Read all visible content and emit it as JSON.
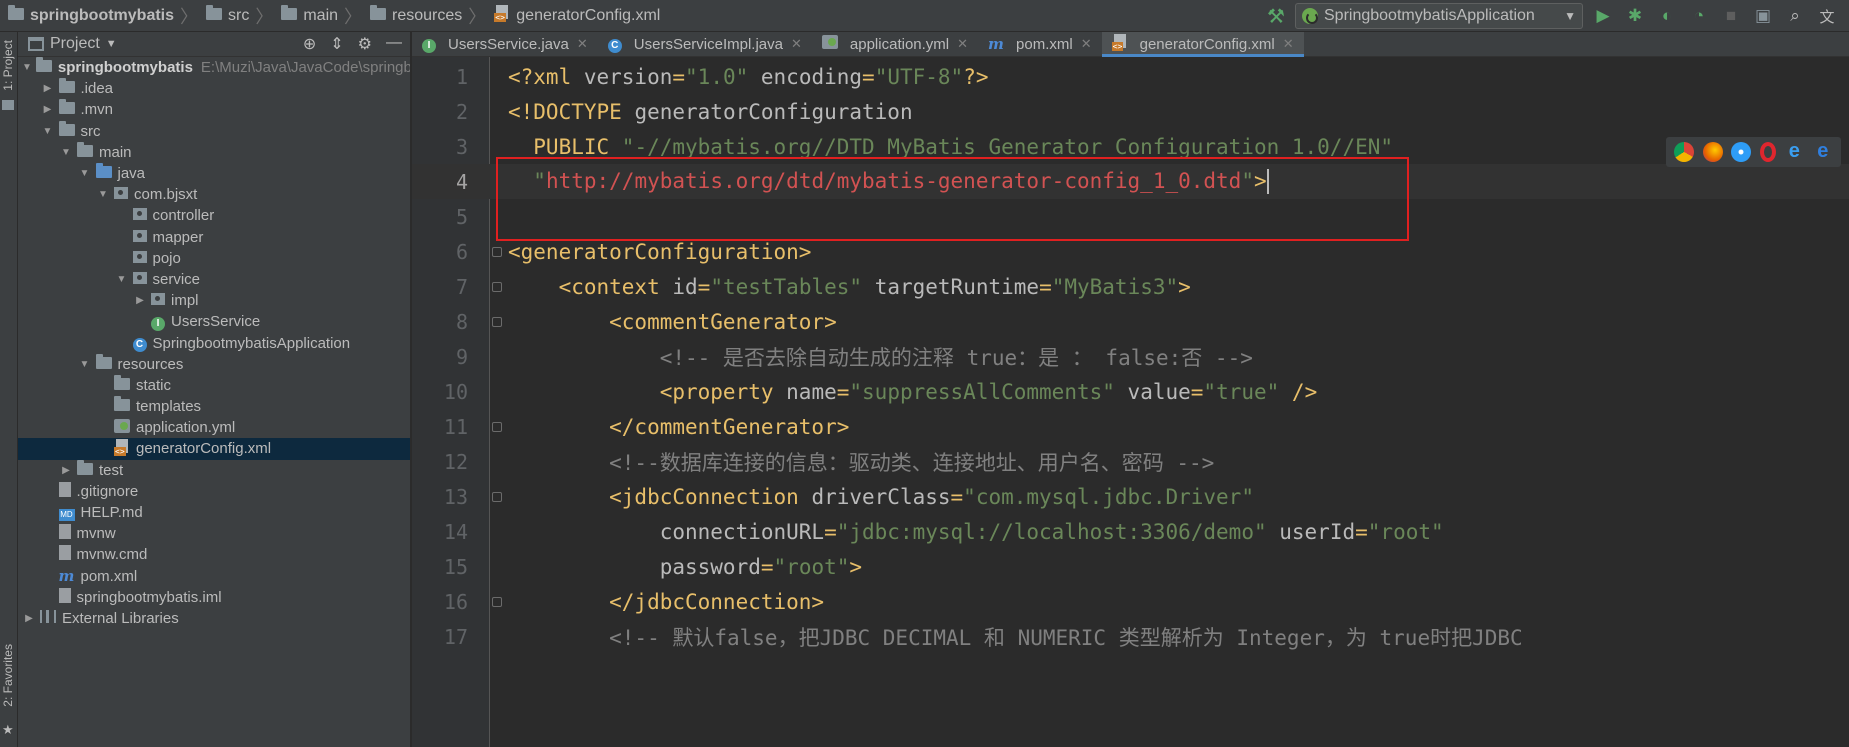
{
  "breadcrumb": [
    {
      "label": "springbootmybatis",
      "icon": "folder-icon"
    },
    {
      "label": "src",
      "icon": "folder-icon"
    },
    {
      "label": "main",
      "icon": "folder-icon"
    },
    {
      "label": "resources",
      "icon": "resources-folder-icon"
    },
    {
      "label": "generatorConfig.xml",
      "icon": "xml-file-icon"
    }
  ],
  "toolbar": {
    "run_config": "SpringbootmybatisApplication"
  },
  "left_strip": {
    "project_label": "1: Project",
    "favorites_label": "2: Favorites"
  },
  "project_panel": {
    "title": "Project",
    "tree": [
      {
        "depth": 0,
        "arrow": "down",
        "icon": "module-folder-icon",
        "label": "springbootmybatis",
        "bold": true,
        "path": "E:\\Muzi\\Java\\JavaCode\\springboot\\s"
      },
      {
        "depth": 1,
        "arrow": "right",
        "icon": "folder-icon",
        "label": ".idea"
      },
      {
        "depth": 1,
        "arrow": "right",
        "icon": "folder-icon",
        "label": ".mvn"
      },
      {
        "depth": 1,
        "arrow": "down",
        "icon": "folder-icon",
        "label": "src"
      },
      {
        "depth": 2,
        "arrow": "down",
        "icon": "folder-icon",
        "label": "main"
      },
      {
        "depth": 3,
        "arrow": "down",
        "icon": "source-folder-icon",
        "label": "java"
      },
      {
        "depth": 4,
        "arrow": "down",
        "icon": "package-icon",
        "label": "com.bjsxt"
      },
      {
        "depth": 5,
        "arrow": "none",
        "icon": "package-icon",
        "label": "controller"
      },
      {
        "depth": 5,
        "arrow": "none",
        "icon": "package-icon",
        "label": "mapper"
      },
      {
        "depth": 5,
        "arrow": "none",
        "icon": "package-icon",
        "label": "pojo"
      },
      {
        "depth": 5,
        "arrow": "down",
        "icon": "package-icon",
        "label": "service"
      },
      {
        "depth": 6,
        "arrow": "right",
        "icon": "package-icon",
        "label": "impl"
      },
      {
        "depth": 6,
        "arrow": "none",
        "icon": "interface-icon",
        "label": "UsersService"
      },
      {
        "depth": 5,
        "arrow": "none",
        "icon": "spring-boot-class-icon",
        "label": "SpringbootmybatisApplication"
      },
      {
        "depth": 3,
        "arrow": "down",
        "icon": "resources-folder-icon",
        "label": "resources"
      },
      {
        "depth": 4,
        "arrow": "none",
        "icon": "folder-icon",
        "label": "static"
      },
      {
        "depth": 4,
        "arrow": "none",
        "icon": "folder-icon",
        "label": "templates"
      },
      {
        "depth": 4,
        "arrow": "none",
        "icon": "yml-file-icon",
        "label": "application.yml"
      },
      {
        "depth": 4,
        "arrow": "none",
        "icon": "xml-file-icon",
        "label": "generatorConfig.xml",
        "selected": true
      },
      {
        "depth": 2,
        "arrow": "right",
        "icon": "folder-icon",
        "label": "test"
      },
      {
        "depth": 1,
        "arrow": "none",
        "icon": "gitignore-file-icon",
        "label": ".gitignore"
      },
      {
        "depth": 1,
        "arrow": "none",
        "icon": "markdown-file-icon",
        "label": "HELP.md"
      },
      {
        "depth": 1,
        "arrow": "none",
        "icon": "text-file-icon",
        "label": "mvnw"
      },
      {
        "depth": 1,
        "arrow": "none",
        "icon": "text-file-icon",
        "label": "mvnw.cmd"
      },
      {
        "depth": 1,
        "arrow": "none",
        "icon": "maven-icon",
        "label": "pom.xml"
      },
      {
        "depth": 1,
        "arrow": "none",
        "icon": "iml-file-icon",
        "label": "springbootmybatis.iml"
      },
      {
        "depth": 0,
        "arrow": "right",
        "icon": "libraries-icon",
        "label": "External Libraries"
      }
    ]
  },
  "tabs": [
    {
      "label": "UsersService.java",
      "icon": "interface-icon",
      "active": false
    },
    {
      "label": "UsersServiceImpl.java",
      "icon": "class-icon",
      "active": false
    },
    {
      "label": "application.yml",
      "icon": "yml-file-icon",
      "active": false
    },
    {
      "label": "pom.xml",
      "icon": "maven-icon",
      "active": false
    },
    {
      "label": "generatorConfig.xml",
      "icon": "xml-file-icon",
      "active": true
    }
  ],
  "editor": {
    "current_line": 4,
    "lines": [
      {
        "n": "1",
        "fold": false,
        "segments": [
          [
            "tag",
            "<?xml "
          ],
          [
            "attr",
            "version"
          ],
          [
            "tag",
            "="
          ],
          [
            "val",
            "\"1.0\""
          ],
          [
            "attr",
            " encoding"
          ],
          [
            "tag",
            "="
          ],
          [
            "val",
            "\"UTF-8\""
          ],
          [
            "tag",
            "?>"
          ]
        ]
      },
      {
        "n": "2",
        "fold": false,
        "segments": [
          [
            "tag",
            "<!DOCTYPE "
          ],
          [
            "attr",
            "generatorConfiguration"
          ]
        ]
      },
      {
        "n": "3",
        "fold": false,
        "segments": [
          [
            "tag",
            "  PUBLIC "
          ],
          [
            "val",
            "\"-//mybatis.org//DTD MyBatis Generator Configuration 1.0//EN\""
          ]
        ]
      },
      {
        "n": "4",
        "fold": false,
        "segments": [
          [
            "tag",
            "  "
          ],
          [
            "val",
            "\""
          ],
          [
            "red",
            "http://mybatis.org/dtd/mybatis-generator-config_1_0.dtd"
          ],
          [
            "val",
            "\""
          ],
          [
            "tag",
            ">"
          ]
        ],
        "cursor": true
      },
      {
        "n": "5",
        "fold": false,
        "segments": []
      },
      {
        "n": "6",
        "fold": true,
        "segments": [
          [
            "tag",
            "<generatorConfiguration>"
          ]
        ]
      },
      {
        "n": "7",
        "fold": true,
        "segments": [
          [
            "tag",
            "    <context "
          ],
          [
            "attr",
            "id"
          ],
          [
            "tag",
            "="
          ],
          [
            "val",
            "\"testTables\""
          ],
          [
            "attr",
            " targetRuntime"
          ],
          [
            "tag",
            "="
          ],
          [
            "val",
            "\"MyBatis3\""
          ],
          [
            "tag",
            ">"
          ]
        ]
      },
      {
        "n": "8",
        "fold": true,
        "segments": [
          [
            "tag",
            "        <commentGenerator>"
          ]
        ]
      },
      {
        "n": "9",
        "fold": false,
        "segments": [
          [
            "com",
            "            <!-- 是否去除自动生成的注释 true：是 ： false:否 -->"
          ]
        ]
      },
      {
        "n": "10",
        "fold": false,
        "segments": [
          [
            "tag",
            "            <property "
          ],
          [
            "attr",
            "name"
          ],
          [
            "tag",
            "="
          ],
          [
            "val",
            "\"suppressAllComments\""
          ],
          [
            "attr",
            " value"
          ],
          [
            "tag",
            "="
          ],
          [
            "val",
            "\"true\""
          ],
          [
            "tag",
            " />"
          ]
        ]
      },
      {
        "n": "11",
        "fold": true,
        "segments": [
          [
            "tag",
            "        </commentGenerator>"
          ]
        ]
      },
      {
        "n": "12",
        "fold": false,
        "segments": [
          [
            "com",
            "        <!--数据库连接的信息：驱动类、连接地址、用户名、密码 -->"
          ]
        ]
      },
      {
        "n": "13",
        "fold": true,
        "segments": [
          [
            "tag",
            "        <jdbcConnection "
          ],
          [
            "attr",
            "driverClass"
          ],
          [
            "tag",
            "="
          ],
          [
            "val",
            "\"com.mysql.jdbc.Driver\""
          ]
        ]
      },
      {
        "n": "14",
        "fold": false,
        "segments": [
          [
            "attr",
            "            connectionURL"
          ],
          [
            "tag",
            "="
          ],
          [
            "val",
            "\"jdbc:mysql://localhost:3306/demo\""
          ],
          [
            "attr",
            " userId"
          ],
          [
            "tag",
            "="
          ],
          [
            "val",
            "\"root\""
          ]
        ]
      },
      {
        "n": "15",
        "fold": false,
        "segments": [
          [
            "attr",
            "            password"
          ],
          [
            "tag",
            "="
          ],
          [
            "val",
            "\"root\""
          ],
          [
            "tag",
            ">"
          ]
        ]
      },
      {
        "n": "16",
        "fold": true,
        "segments": [
          [
            "tag",
            "        </jdbcConnection>"
          ]
        ]
      },
      {
        "n": "17",
        "fold": false,
        "segments": [
          [
            "com",
            "        <!-- 默认false，把JDBC DECIMAL 和 NUMERIC 类型解析为 Integer，为 true时把JDBC"
          ]
        ]
      }
    ]
  },
  "colors": {
    "highlight_box": "#e02020",
    "selection": "#0d293e",
    "active_tab_underline": "#4a88c7"
  }
}
